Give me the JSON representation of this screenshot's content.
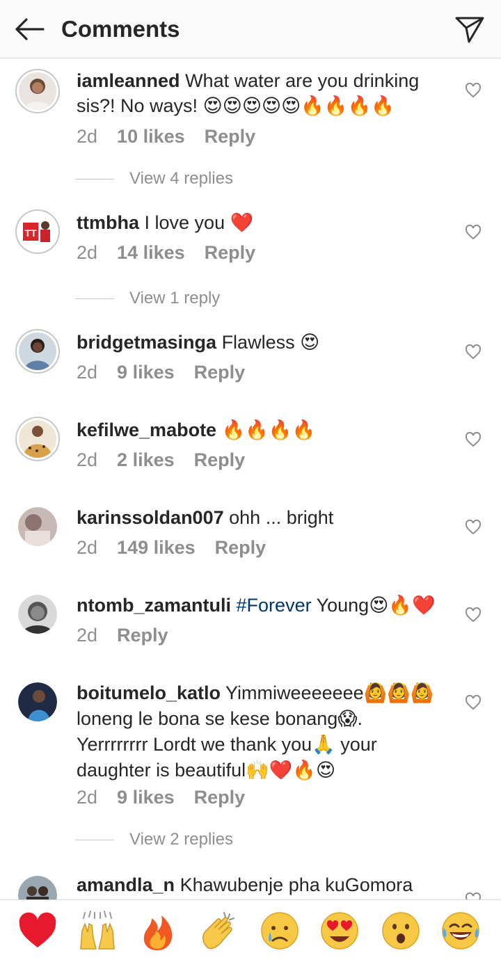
{
  "header": {
    "title": "Comments",
    "back_icon": "arrow-left-icon",
    "send_icon": "paper-plane-icon"
  },
  "comments": [
    {
      "username": "iamleanned",
      "text": "What water are you drinking sis?! No ways!",
      "emoji": "😍😍😍😍😍🔥🔥🔥🔥",
      "time": "2d",
      "likes": "10 likes",
      "reply": "Reply",
      "view_replies": "View 4 replies"
    },
    {
      "username": "ttmbha",
      "text": "I love you",
      "emoji": "❤️",
      "time": "2d",
      "likes": "14 likes",
      "reply": "Reply",
      "view_replies": "View 1 reply"
    },
    {
      "username": "bridgetmasinga",
      "text": "Flawless",
      "emoji": "😍",
      "time": "2d",
      "likes": "9 likes",
      "reply": "Reply"
    },
    {
      "username": "kefilwe_mabote",
      "text": "",
      "emoji": "🔥🔥🔥🔥",
      "time": "2d",
      "likes": "2 likes",
      "reply": "Reply"
    },
    {
      "username": "karinssoldan007",
      "text": "ohh ... bright",
      "time": "2d",
      "likes": "149 likes",
      "reply": "Reply"
    },
    {
      "username": "ntomb_zamantuli",
      "hashtag": "#Forever",
      "text": "Young",
      "emoji": "😍🔥❤️",
      "time": "2d",
      "reply": "Reply"
    },
    {
      "username": "boitumelo_katlo",
      "text_1": "Yimmiweeeeeee",
      "emoji_1": "🙆🙆🙆",
      "text_2": "loneng le bona se kese bonang",
      "emoji_2": "😱",
      "text_3": ". Yerrrrrrrr Lordt we thank you",
      "emoji_3": "🙏",
      "text_4": " your daughter is beautiful",
      "emoji_4": "🙌❤️🔥😍",
      "time": "2d",
      "likes": "9 likes",
      "reply": "Reply",
      "view_replies": "View 2 replies"
    },
    {
      "username": "amandla_n",
      "text": "Khawubenje pha kuGomora"
    }
  ],
  "quick_reactions": [
    "❤️",
    "🙌",
    "🔥",
    "👏",
    "😢",
    "😍",
    "😮",
    "😂"
  ],
  "colors": {
    "text": "#262626",
    "secondary": "#8e8e8e",
    "link": "#00376b",
    "divider": "#dbdbdb",
    "header_bg": "#fafafa"
  }
}
